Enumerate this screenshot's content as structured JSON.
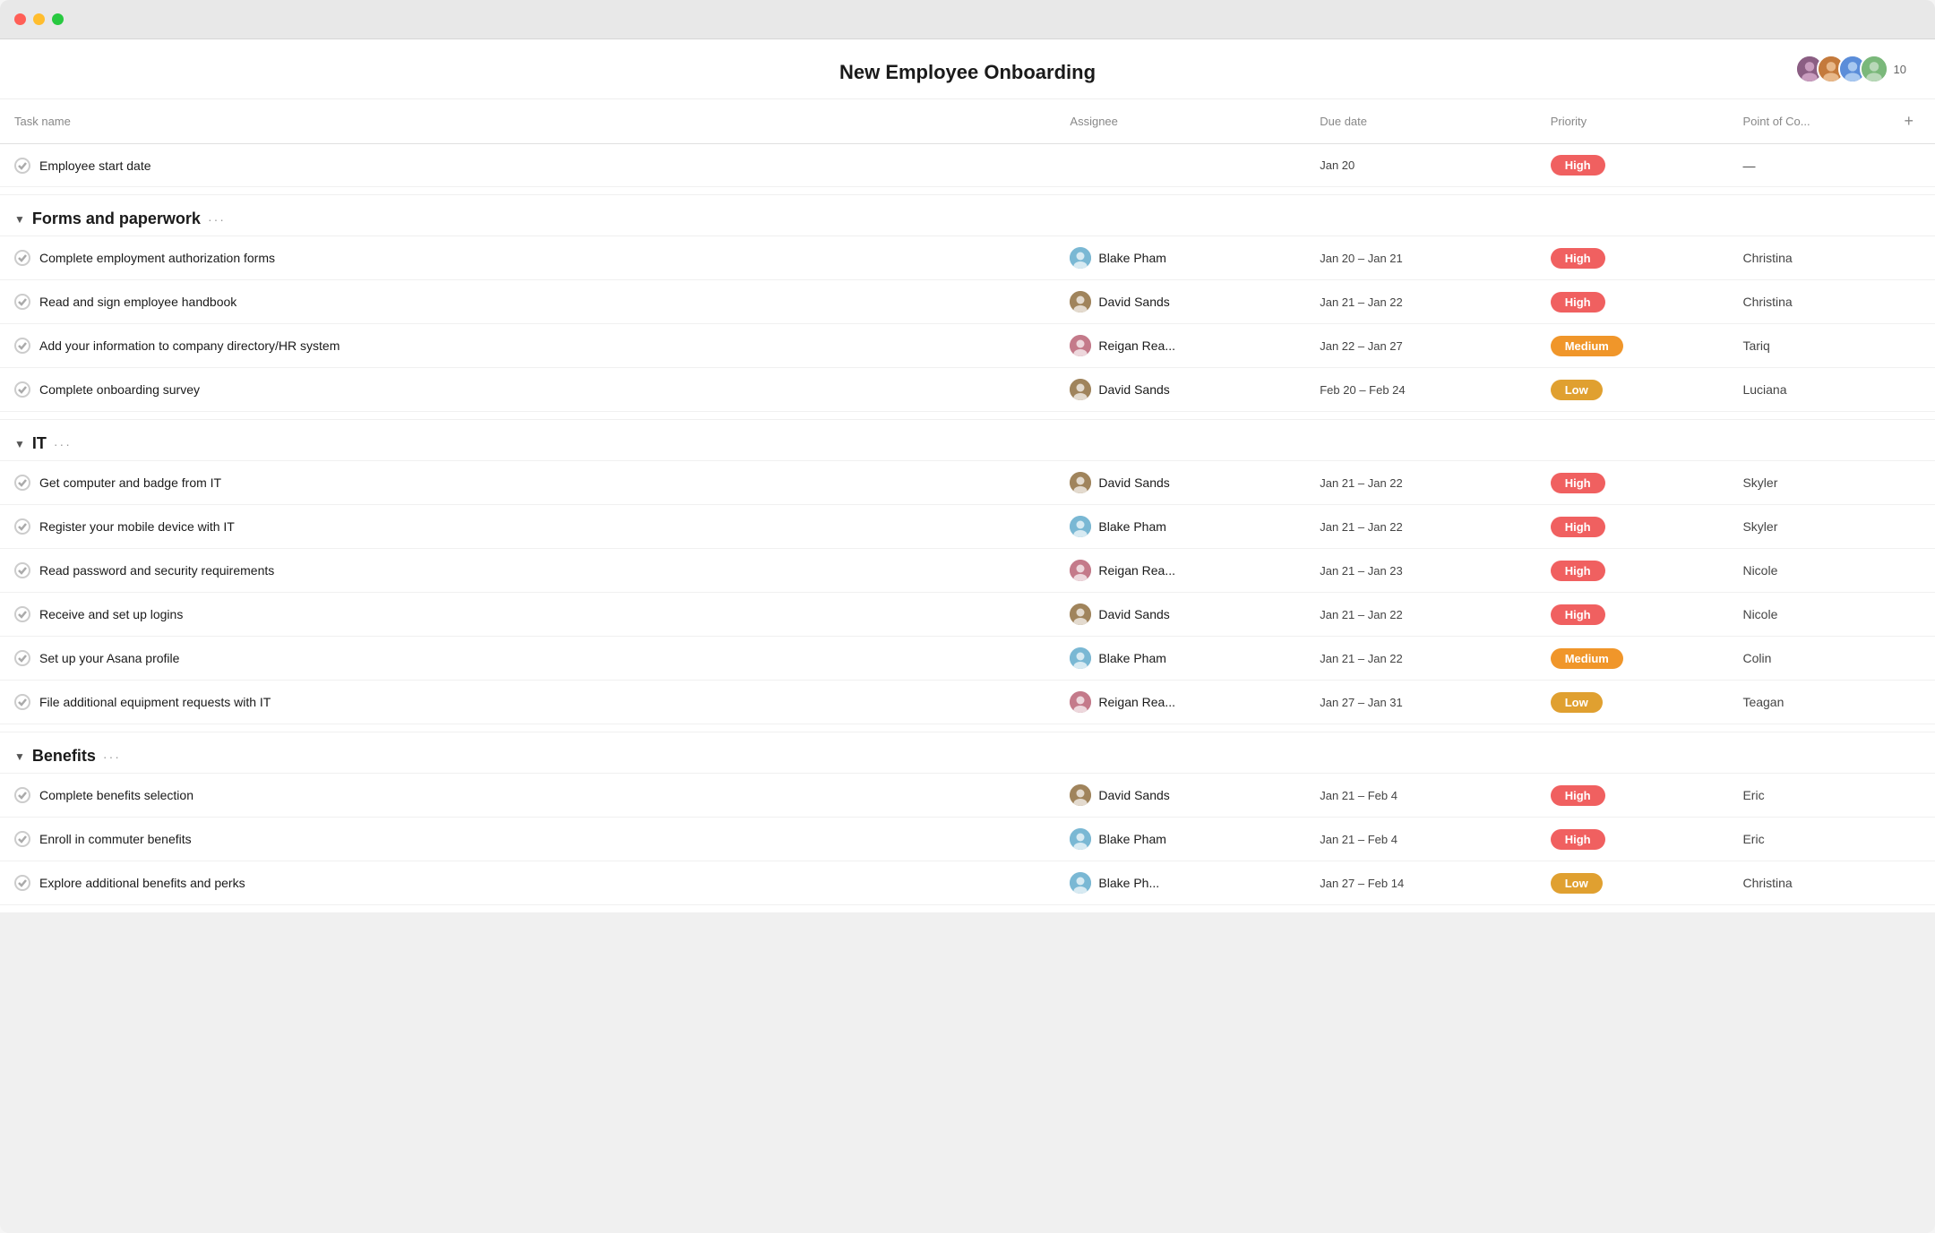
{
  "window": {
    "title": "New Employee Onboarding"
  },
  "header": {
    "title": "New Employee Onboarding",
    "avatar_count": "10"
  },
  "columns": {
    "task_name": "Task name",
    "assignee": "Assignee",
    "due_date": "Due date",
    "priority": "Priority",
    "poc": "Point of Co...",
    "add": "+"
  },
  "top_task": {
    "name": "Employee start date",
    "assignee": "",
    "due_date": "Jan 20",
    "priority": "High",
    "priority_level": "high",
    "poc": "—"
  },
  "sections": [
    {
      "id": "forms",
      "title": "Forms and paperwork",
      "tasks": [
        {
          "name": "Complete employment authorization forms",
          "assignee": "Blake Pham",
          "assignee_class": "a-blake",
          "due_date": "Jan 20 – Jan 21",
          "priority": "High",
          "priority_level": "high",
          "poc": "Christina"
        },
        {
          "name": "Read and sign employee handbook",
          "assignee": "David Sands",
          "assignee_class": "a-david",
          "due_date": "Jan 21 – Jan 22",
          "priority": "High",
          "priority_level": "high",
          "poc": "Christina"
        },
        {
          "name": "Add your information to company directory/HR system",
          "assignee": "Reigan Rea...",
          "assignee_class": "a-reigan",
          "due_date": "Jan 22 – Jan 27",
          "priority": "Medium",
          "priority_level": "medium",
          "poc": "Tariq"
        },
        {
          "name": "Complete onboarding survey",
          "assignee": "David Sands",
          "assignee_class": "a-david",
          "due_date": "Feb 20 – Feb 24",
          "priority": "Low",
          "priority_level": "low",
          "poc": "Luciana"
        }
      ]
    },
    {
      "id": "it",
      "title": "IT",
      "tasks": [
        {
          "name": "Get computer and badge from IT",
          "assignee": "David Sands",
          "assignee_class": "a-david",
          "due_date": "Jan 21 – Jan 22",
          "priority": "High",
          "priority_level": "high",
          "poc": "Skyler"
        },
        {
          "name": "Register your mobile device with IT",
          "assignee": "Blake Pham",
          "assignee_class": "a-blake",
          "due_date": "Jan 21 – Jan 22",
          "priority": "High",
          "priority_level": "high",
          "poc": "Skyler"
        },
        {
          "name": "Read password and security requirements",
          "assignee": "Reigan Rea...",
          "assignee_class": "a-reigan",
          "due_date": "Jan 21 – Jan 23",
          "priority": "High",
          "priority_level": "high",
          "poc": "Nicole"
        },
        {
          "name": "Receive and set up logins",
          "assignee": "David Sands",
          "assignee_class": "a-david",
          "due_date": "Jan 21 – Jan 22",
          "priority": "High",
          "priority_level": "high",
          "poc": "Nicole"
        },
        {
          "name": "Set up your Asana profile",
          "assignee": "Blake Pham",
          "assignee_class": "a-blake",
          "due_date": "Jan 21 – Jan 22",
          "priority": "Medium",
          "priority_level": "medium",
          "poc": "Colin"
        },
        {
          "name": "File additional equipment requests with IT",
          "assignee": "Reigan Rea...",
          "assignee_class": "a-reigan",
          "due_date": "Jan 27 – Jan 31",
          "priority": "Low",
          "priority_level": "low",
          "poc": "Teagan"
        }
      ]
    },
    {
      "id": "benefits",
      "title": "Benefits",
      "tasks": [
        {
          "name": "Complete benefits selection",
          "assignee": "David Sands",
          "assignee_class": "a-david",
          "due_date": "Jan 21 – Feb 4",
          "priority": "High",
          "priority_level": "high",
          "poc": "Eric"
        },
        {
          "name": "Enroll in commuter benefits",
          "assignee": "Blake Pham",
          "assignee_class": "a-blake",
          "due_date": "Jan 21 – Feb 4",
          "priority": "High",
          "priority_level": "high",
          "poc": "Eric"
        },
        {
          "name": "Explore additional benefits and perks",
          "assignee": "Blake Ph...",
          "assignee_class": "a-blake",
          "due_date": "Jan 27 – Feb 14",
          "priority": "Low",
          "priority_level": "low",
          "poc": "Christina"
        }
      ]
    }
  ]
}
